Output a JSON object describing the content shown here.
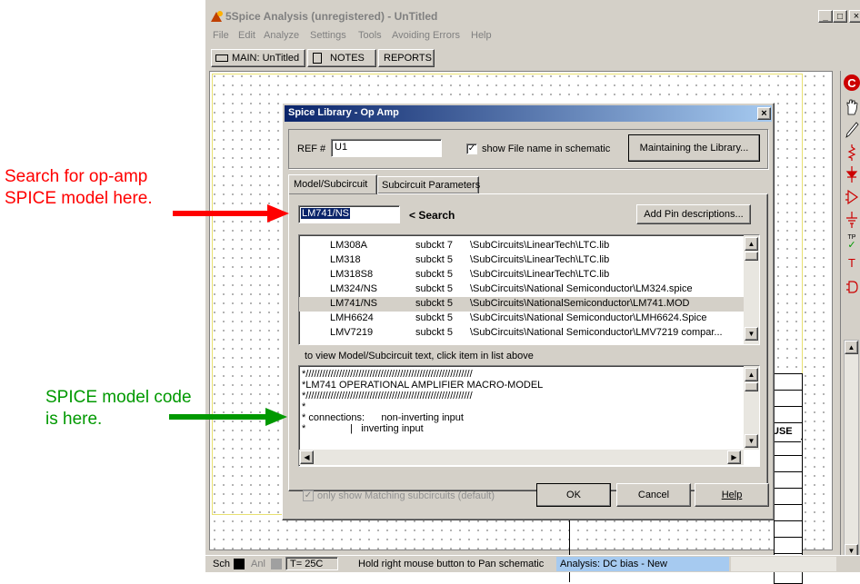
{
  "annotations": {
    "search_note_line1": "Search for op-amp",
    "search_note_line2": "SPICE model here.",
    "code_note_line1": "SPICE model code",
    "code_note_line2": "is here."
  },
  "app": {
    "title": "5Spice Analysis (unregistered) - UnTitled",
    "menu": [
      "File",
      "Edit",
      "Analyze",
      "Settings",
      "Tools",
      "Avoiding Errors",
      "Help"
    ],
    "tabs": [
      "MAIN: UnTitled",
      "NOTES",
      "REPORTS"
    ],
    "window_controls": [
      "_",
      "□",
      "×"
    ]
  },
  "dialog": {
    "title": "Spice Library - Op Amp",
    "close": "×",
    "ref_label": "REF #",
    "ref_value": "U1",
    "show_filename_label": "show File name in schematic",
    "maintain_button": "Maintaining the Library...",
    "tabs": [
      "Model/Subcircuit",
      "Subcircuit Parameters"
    ],
    "search_value": "LM741/NS",
    "search_label": "< Search",
    "add_pin_button": "Add Pin descriptions...",
    "library_rows": [
      {
        "name": "LM308A",
        "type": "subckt 7",
        "path": "\\SubCircuits\\LinearTech\\LTC.lib"
      },
      {
        "name": "LM318",
        "type": "subckt 5",
        "path": "\\SubCircuits\\LinearTech\\LTC.lib"
      },
      {
        "name": "LM318S8",
        "type": "subckt 5",
        "path": "\\SubCircuits\\LinearTech\\LTC.lib"
      },
      {
        "name": "LM324/NS",
        "type": "subckt 5",
        "path": "\\SubCircuits\\National Semiconductor\\LM324.spice"
      },
      {
        "name": "LM741/NS",
        "type": "subckt 5",
        "path": "\\SubCircuits\\NationalSemiconductor\\LM741.MOD"
      },
      {
        "name": "LMH6624",
        "type": "subckt 5",
        "path": "\\SubCircuits\\National Semiconductor\\LMH6624.Spice"
      },
      {
        "name": "LMV7219",
        "type": "subckt 5",
        "path": "\\SubCircuits\\National Semiconductor\\LMV7219 compar..."
      }
    ],
    "view_hint": "to view Model/Subcircuit text, click item in list above",
    "code_lines": [
      "*////////////////////////////////////////////////////////////",
      "*LM741 OPERATIONAL AMPLIFIER MACRO-MODEL",
      "*////////////////////////////////////////////////////////////",
      "*",
      "* connections:      non-inverting input",
      "*                |   inverting input"
    ],
    "only_show_label": "only show Matching subcircuits (default)",
    "ok": "OK",
    "cancel": "Cancel",
    "help": "Help"
  },
  "background_fragment": "USE",
  "status": {
    "sch": "Sch",
    "anl": "Anl",
    "temp": "T= 25C",
    "hint": "Hold right mouse button to Pan schematic",
    "analysis": "Analysis:  DC bias - New"
  },
  "toolbar_icons": [
    "logo-c-icon",
    "hand-icon",
    "pencil-icon",
    "resistor-icon",
    "diode-icon",
    "opamp-icon",
    "ground-icon",
    "testpoint-icon",
    "text-icon",
    "gate-icon"
  ],
  "colors": {
    "title_bar_inactive": "#d4d0c8",
    "dialog_title_start": "#0a246a",
    "dialog_title_end": "#a6caf0",
    "red_note": "#ff0000",
    "green_note": "#009900",
    "selected_row": "#d4d0c8",
    "search_highlight": "#0a246a"
  }
}
